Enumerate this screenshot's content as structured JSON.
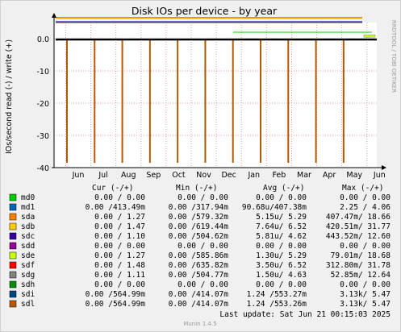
{
  "chart_data": {
    "type": "line",
    "title": "Disk IOs per device - by year",
    "ylabel": "IOs/second read (-) / write (+)",
    "watermark": "RRDTOOL / TOBI OETIKER",
    "ylim": [
      -40,
      5
    ],
    "y_ticks": [
      {
        "value": 0,
        "label": "0.0"
      },
      {
        "value": -10,
        "label": "-10"
      },
      {
        "value": -20,
        "label": "-20"
      },
      {
        "value": -30,
        "label": "-30"
      },
      {
        "value": -40,
        "label": "-40"
      }
    ],
    "x_ticks": [
      "Jun",
      "Jul",
      "Aug",
      "Sep",
      "Oct",
      "Nov",
      "Dec",
      "Jan",
      "Feb",
      "Mar",
      "Apr",
      "May",
      "Jun"
    ],
    "read_spike_value": -38.5,
    "write_band_values": [
      5.29,
      6.52
    ],
    "legend_headers": {
      "cur": "Cur (-/+)",
      "min": "Min (-/+)",
      "avg": "Avg (-/+)",
      "max": "Max (-/+)"
    },
    "series": [
      {
        "name": "md0",
        "color": "#00cc00",
        "cur": "0.00 /  0.00",
        "min": "0.00 /  0.00",
        "avg": "0.00 /  0.00",
        "max": "0.00 /  0.00"
      },
      {
        "name": "md1",
        "color": "#0066b3",
        "cur": "0.00 /413.49m",
        "min": "0.00 /317.94m",
        "avg": "90.68u/407.38m",
        "max": "2.25 /  4.06"
      },
      {
        "name": "sda",
        "color": "#ff8000",
        "cur": "0.00 /  1.27",
        "min": "0.00 /579.32m",
        "avg": "5.15u/  5.29",
        "max": "407.47m/ 18.66"
      },
      {
        "name": "sdb",
        "color": "#ffcc00",
        "cur": "0.00 /  1.47",
        "min": "0.00 /619.44m",
        "avg": "7.64u/  6.52",
        "max": "420.51m/ 31.77"
      },
      {
        "name": "sdc",
        "color": "#330099",
        "cur": "0.00 /  1.10",
        "min": "0.00 /504.62m",
        "avg": "5.81u/  4.62",
        "max": "443.52m/ 12.60"
      },
      {
        "name": "sdd",
        "color": "#990099",
        "cur": "0.00 /  0.00",
        "min": "0.00 /  0.00",
        "avg": "0.00 /  0.00",
        "max": "0.00 /  0.00"
      },
      {
        "name": "sde",
        "color": "#ccff00",
        "cur": "0.00 /  1.27",
        "min": "0.00 /585.86m",
        "avg": "1.30u/  5.29",
        "max": "79.01m/ 18.68"
      },
      {
        "name": "sdf",
        "color": "#ff0000",
        "cur": "0.00 /  1.48",
        "min": "0.00 /635.82m",
        "avg": "3.50u/  6.52",
        "max": "312.80m/ 31.78"
      },
      {
        "name": "sdg",
        "color": "#808080",
        "cur": "0.00 /  1.11",
        "min": "0.00 /504.77m",
        "avg": "1.50u/  4.63",
        "max": "52.85m/ 12.64"
      },
      {
        "name": "sdh",
        "color": "#008f00",
        "cur": "0.00 /  0.00",
        "min": "0.00 /  0.00",
        "avg": "0.00 /  0.00",
        "max": "0.00 /  0.00"
      },
      {
        "name": "sdi",
        "color": "#00487d",
        "cur": "0.00 /564.99m",
        "min": "0.00 /414.07m",
        "avg": "1.24 /553.27m",
        "max": "3.13k/  5.47"
      },
      {
        "name": "sdl",
        "color": "#b35a00",
        "cur": "0.00 /564.99m",
        "min": "0.00 /414.07m",
        "avg": "1.24 /553.26m",
        "max": "3.13k/  5.47"
      }
    ],
    "last_update": "Last update:  Sat Jun 21 00:15:03 2025",
    "footer": "Munin 1.4.5"
  }
}
